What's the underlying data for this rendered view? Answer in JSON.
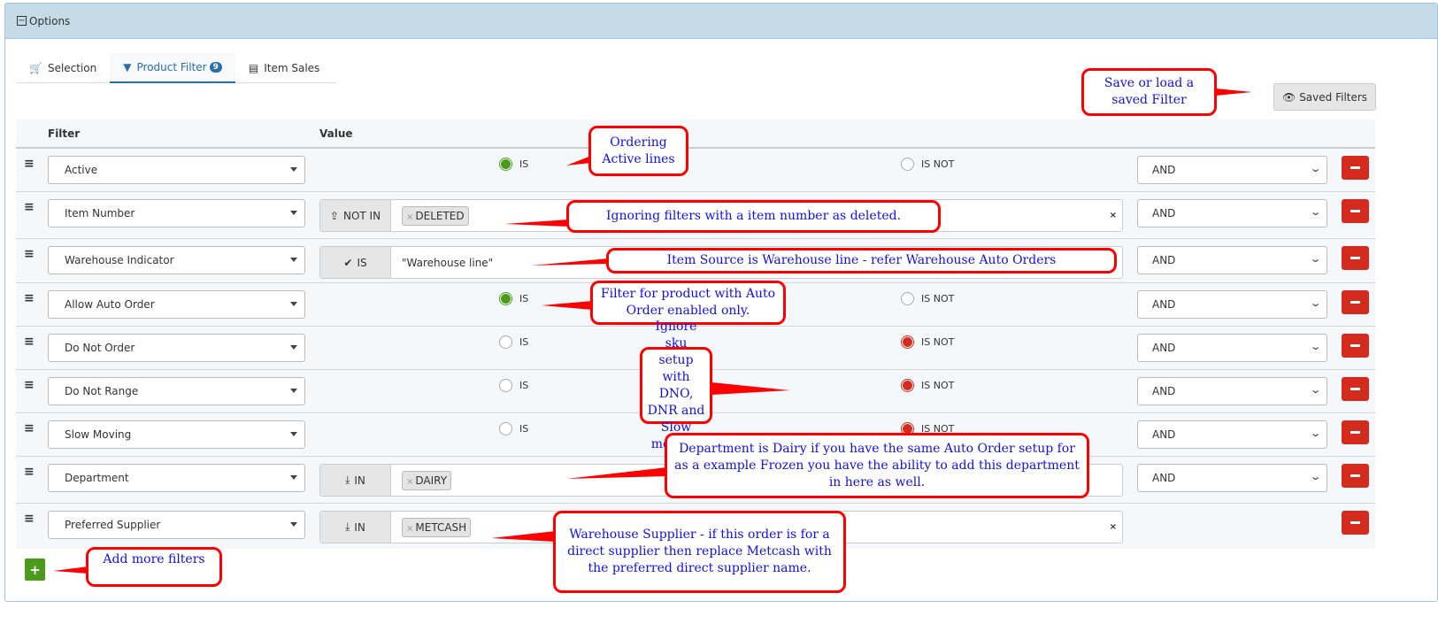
{
  "panel": {
    "title": "Options",
    "collapse_icon": "minus-square-icon"
  },
  "tabs": [
    {
      "label": "Selection",
      "icon": "cart-icon",
      "active": false
    },
    {
      "label": "Product Filter",
      "icon": "filter-icon",
      "active": true,
      "badge": "9"
    },
    {
      "label": "Item Sales",
      "icon": "file-icon",
      "active": false
    }
  ],
  "saved_filters": {
    "label": "Saved Filters",
    "icon": "eye-icon"
  },
  "table": {
    "headers": {
      "filter": "Filter",
      "value": "Value"
    }
  },
  "rows": [
    {
      "filter": "Active",
      "type": "radio",
      "selected": "IS",
      "is": "IS",
      "is_not": "IS NOT",
      "logic": "AND"
    },
    {
      "filter": "Item Number",
      "type": "tags",
      "operator": "NOT IN",
      "op_icon": "upload-icon",
      "tags": [
        "DELETED"
      ],
      "clearable": true,
      "logic": "AND"
    },
    {
      "filter": "Warehouse Indicator",
      "type": "text",
      "operator": "IS",
      "op_icon": "check-icon",
      "value": "\"Warehouse line\"",
      "logic": "AND"
    },
    {
      "filter": "Allow Auto Order",
      "type": "radio",
      "selected": "IS",
      "is": "IS",
      "is_not": "IS NOT",
      "logic": "AND"
    },
    {
      "filter": "Do Not Order",
      "type": "radio",
      "selected": "IS NOT",
      "is": "IS",
      "is_not": "IS NOT",
      "logic": "AND"
    },
    {
      "filter": "Do Not Range",
      "type": "radio",
      "selected": "IS NOT",
      "is": "IS",
      "is_not": "IS NOT",
      "logic": "AND"
    },
    {
      "filter": "Slow Moving",
      "type": "radio",
      "selected": "IS NOT",
      "is": "IS",
      "is_not": "IS NOT",
      "logic": "AND"
    },
    {
      "filter": "Department",
      "type": "tags",
      "operator": "IN",
      "op_icon": "download-icon",
      "tags": [
        "DAIRY"
      ],
      "clearable": false,
      "logic": "AND"
    },
    {
      "filter": "Preferred Supplier",
      "type": "tags",
      "operator": "IN",
      "op_icon": "download-icon",
      "tags": [
        "METCASH"
      ],
      "clearable": true,
      "logic": ""
    }
  ],
  "add_button": {
    "label": "+"
  },
  "annotations": [
    "Save or load a saved Filter",
    "Ordering Active lines",
    "Ignoring filters with a item number as deleted.",
    "Item Source is Warehouse line - refer Warehouse Auto Orders",
    "Filter for product with Auto Order enabled only.",
    "Ignore sku setup with DNO, DNR and Slow moving.",
    "Department is Dairy if you have the same Auto Order setup for as a example Frozen you have the ability to add this department in here as well.",
    "Warehouse Supplier - if this order is for a direct supplier then replace Metcash with the preferred direct supplier name.",
    "Add more filters"
  ],
  "colors": {
    "header_bg": "#c6dbe8",
    "accent": "#2a6fa8",
    "is_selected": "#4a9a1b",
    "is_not_selected": "#d42b1e",
    "remove": "#d42b1e",
    "add": "#4a9a1b",
    "annotation_border": "#ff0000",
    "annotation_text": "#1010ee"
  }
}
